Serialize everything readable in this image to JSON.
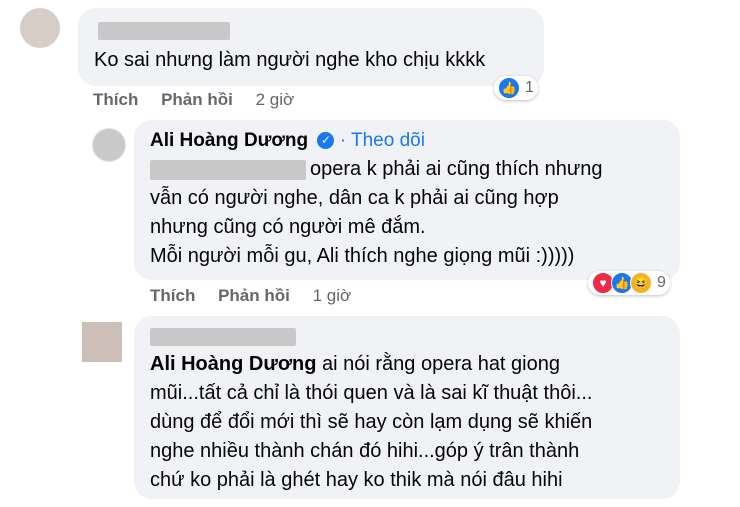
{
  "comments": [
    {
      "text": "Ko sai nhưng làm người nghe kho chịu kkkk",
      "actions": {
        "like": "Thích",
        "reply": "Phản hồi",
        "time": "2 giờ"
      },
      "reaction_count": "1"
    },
    {
      "author": "Ali Hoàng Dương",
      "follow": "· Theo dõi",
      "lines": [
        "opera k phải ai cũng thích nhưng",
        "vẫn có người nghe, dân ca k phải ai cũng hợp",
        "nhưng cũng có người mê đắm.",
        "Mỗi người mỗi gu, Ali thích nghe giọng mũi :)))))"
      ],
      "actions": {
        "like": "Thích",
        "reply": "Phản hồi",
        "time": "1 giờ"
      },
      "reaction_count": "9"
    },
    {
      "mention": "Ali Hoàng Dương",
      "lines": [
        " ai nói rằng opera hat giong",
        "mũi...tất cả chỉ là thói quen và là sai kĩ thuật thôi...",
        "dùng để đổi mới thì sẽ hay còn lạm dụng sẽ khiến",
        "nghe nhiều thành chán đó hihi...góp ý trân thành",
        "chứ ko phải là ghét hay ko thik mà nói đâu hihi"
      ]
    }
  ],
  "icons": {
    "like": "like-icon",
    "love": "love-icon",
    "haha": "haha-icon",
    "verified": "verified-icon"
  }
}
